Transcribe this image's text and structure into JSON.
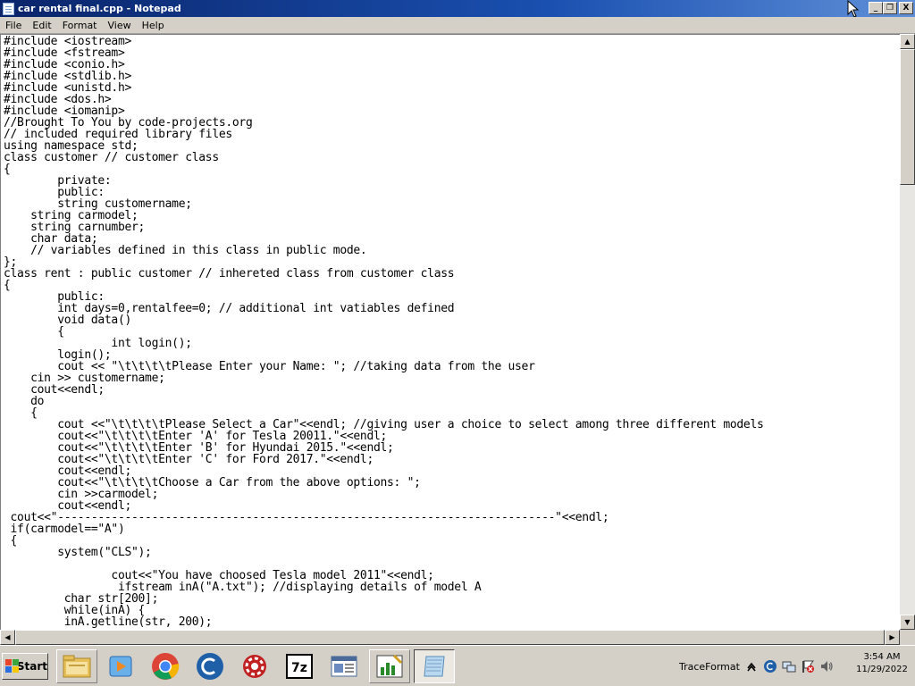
{
  "window": {
    "title": "car rental final.cpp - Notepad",
    "buttons": {
      "minimize": "_",
      "maximize": "❐",
      "close": "X"
    }
  },
  "menu": {
    "items": [
      "File",
      "Edit",
      "Format",
      "View",
      "Help"
    ]
  },
  "editor": {
    "lines": [
      "#include <iostream>",
      "#include <fstream>",
      "#include <conio.h>",
      "#include <stdlib.h>",
      "#include <unistd.h>",
      "#include <dos.h>",
      "#include <iomanip>",
      "//Brought To You by code-projects.org",
      "// included required library files",
      "using namespace std;",
      "class customer // customer class",
      "{",
      "        private:",
      "        public:",
      "        string customername;",
      "    string carmodel;",
      "    string carnumber;",
      "    char data;",
      "    // variables defined in this class in public mode.",
      "};",
      "class rent : public customer // inhereted class from customer class",
      "{",
      "        public:",
      "        int days=0,rentalfee=0; // additional int vatiables defined",
      "        void data()",
      "        {",
      "                int login();",
      "        login();",
      "        cout << \"\\t\\t\\t\\tPlease Enter your Name: \"; //taking data from the user",
      "    cin >> customername;",
      "    cout<<endl;",
      "    do",
      "    {",
      "        cout <<\"\\t\\t\\t\\tPlease Select a Car\"<<endl; //giving user a choice to select among three different models",
      "        cout<<\"\\t\\t\\t\\tEnter 'A' for Tesla 20011.\"<<endl;",
      "        cout<<\"\\t\\t\\t\\tEnter 'B' for Hyundai 2015.\"<<endl;",
      "        cout<<\"\\t\\t\\t\\tEnter 'C' for Ford 2017.\"<<endl;",
      "        cout<<endl;",
      "        cout<<\"\\t\\t\\t\\tChoose a Car from the above options: \";",
      "        cin >>carmodel;",
      "        cout<<endl;",
      " cout<<\"--------------------------------------------------------------------------\"<<endl;",
      " if(carmodel==\"A\")",
      " {",
      "        system(\"CLS\");",
      "",
      "                cout<<\"You have choosed Tesla model 2011\"<<endl;",
      "                 ifstream inA(\"A.txt\"); //displaying details of model A",
      "         char str[200];",
      "         while(inA) {",
      "         inA.getline(str, 200);"
    ]
  },
  "taskbar": {
    "start_label": "Start",
    "apps": [
      {
        "name": "file-explorer-icon"
      },
      {
        "name": "media-player-icon"
      },
      {
        "name": "chrome-icon"
      },
      {
        "name": "ccleaner-icon"
      },
      {
        "name": "settings-gear-icon"
      },
      {
        "name": "7zip-icon"
      },
      {
        "name": "document-viewer-icon"
      },
      {
        "name": "paint-chart-icon"
      },
      {
        "name": "notepad-icon"
      }
    ],
    "tray": {
      "label": "TraceFormat",
      "time": "3:54 AM",
      "date": "11/29/2022"
    }
  }
}
